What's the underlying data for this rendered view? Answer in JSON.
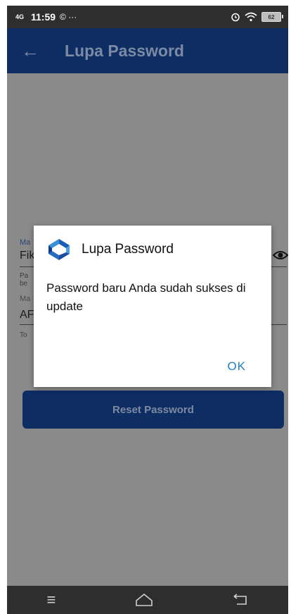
{
  "status_bar": {
    "network": "4G",
    "time": "11:59",
    "notif_icons": "© ···",
    "battery": "62"
  },
  "app_bar": {
    "title": "Lupa Password",
    "back_icon": "←"
  },
  "form": {
    "field1_label": "Ma",
    "field1_value": "Fik",
    "hint1_line1": "Pa",
    "hint1_line2": "be",
    "field2_label": "Ma",
    "field2_value": "AF",
    "hint2": "To",
    "reset_button": "Reset Password"
  },
  "dialog": {
    "title": "Lupa Password",
    "message": "Password baru Anda sudah sukses di update",
    "ok_button": "OK"
  },
  "nav_bar": {
    "menu_icon": "≡",
    "home_icon": "⌂",
    "back_icon": "←"
  },
  "colors": {
    "primary": "#0d2d63",
    "accent": "#1e7fc4",
    "scrim": "#8a8a8a"
  }
}
